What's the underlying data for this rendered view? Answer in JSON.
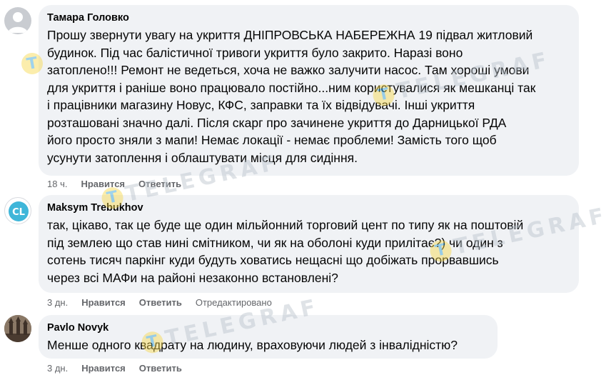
{
  "comments": [
    {
      "author": "Тамара Головко",
      "lines": [
        "Прошу звернути увагу на укриття ДНІПРОВСЬКА НАБЕРЕЖНА 19 підвал житловий",
        "будинок. Під час балістичної тривоги укриття було закрито. Наразі воно",
        "затоплено!!! Ремонт не ведеться, хоча не важко залучити насос. Там хороші умови",
        "для укриття і раніше воно працювало постійно...ним користувалися як мешканці так",
        "і працівники магазину Новус, КФС, заправки та їх відвідувачі. Інші укриття",
        "розташовані значно далі. Після скарг про зачинене укриття до Дарницької РДА",
        "його просто зняли з мапи! Немає локації - немає проблеми! Замість того щоб",
        "усунути затоплення і облаштувати місця для сидіння."
      ],
      "time": "18 ч.",
      "like": "Нравится",
      "reply": "Ответить"
    },
    {
      "author": "Maksym Trebukhov",
      "avatar_text": "CL",
      "lines": [
        "так, цікаво, так це буде ще один мільйонний торговий цент по типу як на поштовій",
        "під землею що став нині смітником, чи як на оболоні куди прилітає?) чи один з",
        "сотень тисяч паркінг куди будуть ховатись нещасні що добіжать прорвавшись",
        "через всі МАФи на районі незаконно встановлені?"
      ],
      "time": "3 дн.",
      "like": "Нравится",
      "reply": "Ответить",
      "edited": "Отредактировано"
    },
    {
      "author": "Pavlo Novyk",
      "lines": [
        "Менше одного квадрату на людину, враховуючи людей з інвалідністю?"
      ],
      "time": "3 дн.",
      "like": "Нравится",
      "reply": "Ответить"
    }
  ],
  "watermark": {
    "text": "TELEGRAF",
    "logo": "T"
  },
  "colors": {
    "bubble": "#f0f2f5",
    "meta": "#65676b",
    "watermark_logo": "#f7d84a"
  }
}
